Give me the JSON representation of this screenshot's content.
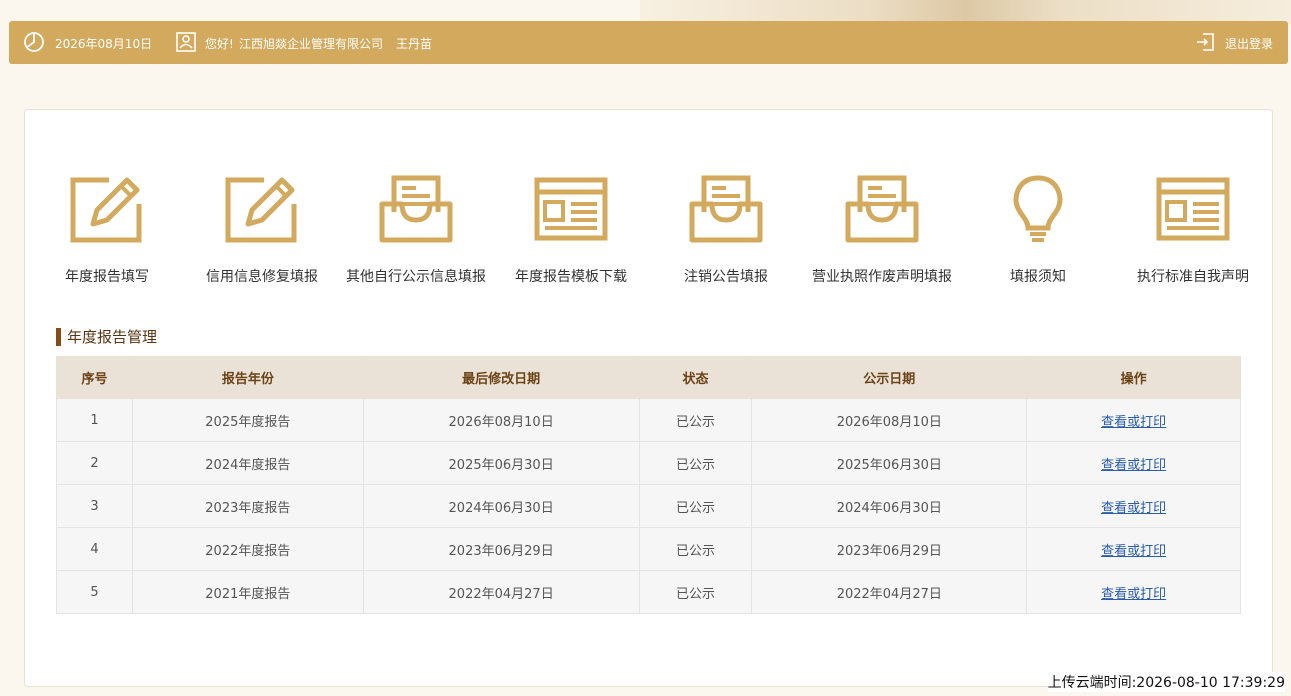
{
  "topbar": {
    "date": "2026年08月10日",
    "greeting": "您好!",
    "company": "江西旭燚企业管理有限公司",
    "username": "王丹苗",
    "logout_label": "退出登录"
  },
  "tools": [
    {
      "label": "年度报告填写",
      "icon": "edit-icon"
    },
    {
      "label": "信用信息修复填报",
      "icon": "edit-icon"
    },
    {
      "label": "其他自行公示信息填报",
      "icon": "inbox-icon"
    },
    {
      "label": "年度报告模板下载",
      "icon": "template-icon"
    },
    {
      "label": "注销公告填报",
      "icon": "inbox-icon"
    },
    {
      "label": "营业执照作废声明填报",
      "icon": "inbox-icon"
    },
    {
      "label": "填报须知",
      "icon": "lightbulb-icon"
    },
    {
      "label": "执行标准自我声明",
      "icon": "template-icon"
    }
  ],
  "section": {
    "title": "年度报告管理"
  },
  "table": {
    "headers": [
      "序号",
      "报告年份",
      "最后修改日期",
      "状态",
      "公示日期",
      "操作"
    ],
    "rows": [
      {
        "no": "1",
        "year": "2025年度报告",
        "modified": "2026年08月10日",
        "status": "已公示",
        "published": "2026年08月10日",
        "action": "查看或打印"
      },
      {
        "no": "2",
        "year": "2024年度报告",
        "modified": "2025年06月30日",
        "status": "已公示",
        "published": "2025年06月30日",
        "action": "查看或打印"
      },
      {
        "no": "3",
        "year": "2023年度报告",
        "modified": "2024年06月30日",
        "status": "已公示",
        "published": "2024年06月30日",
        "action": "查看或打印"
      },
      {
        "no": "4",
        "year": "2022年度报告",
        "modified": "2023年06月29日",
        "status": "已公示",
        "published": "2023年06月29日",
        "action": "查看或打印"
      },
      {
        "no": "5",
        "year": "2021年度报告",
        "modified": "2022年04月27日",
        "status": "已公示",
        "published": "2022年04月27日",
        "action": "查看或打印"
      }
    ]
  },
  "footer": {
    "upload_time": "上传云端时间:2026-08-10 17:39:29"
  },
  "colors": {
    "accent": "#d3aa5d",
    "section_bar": "#8b4a14",
    "link": "#2a5caa"
  }
}
